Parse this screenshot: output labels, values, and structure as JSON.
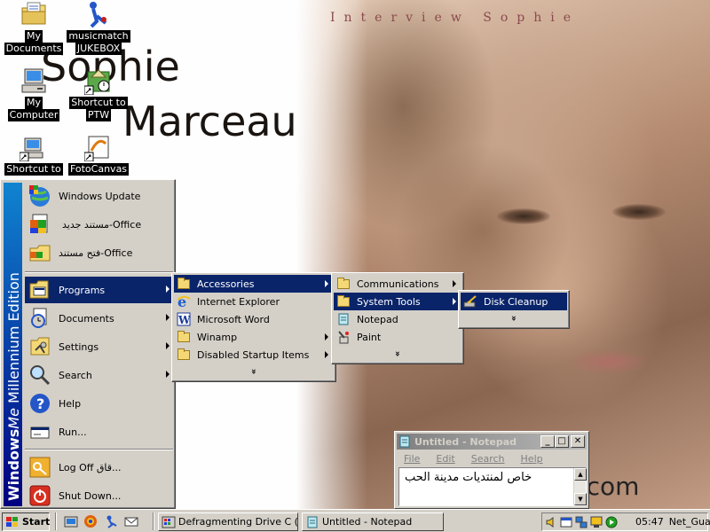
{
  "desktop": {
    "wallpaper": {
      "caption": "Interview Sophie",
      "name_first": "Sophie",
      "name_last": "Marceau",
      "url": "www.ma...ng.com"
    },
    "icons": [
      {
        "label_line1": "My",
        "label_line2": "Documents",
        "icon": "folder-documents-icon"
      },
      {
        "label_line1": "musicmatch",
        "label_line2": "JUKEBOX",
        "icon": "musicmatch-icon"
      },
      {
        "label_line1": "My",
        "label_line2": "Computer",
        "icon": "computer-icon"
      },
      {
        "label_line1": "Shortcut to",
        "label_line2": "PTW",
        "icon": "ptw-shortcut-icon"
      },
      {
        "label_line1": "Shortcut to",
        "label_line2": "",
        "icon": "shortcut-icon"
      },
      {
        "label_line1": "FotoCanvas",
        "label_line2": "",
        "icon": "fotocanvas-icon"
      }
    ]
  },
  "start_menu": {
    "banner_brand": "Windows",
    "banner_me": "Me",
    "banner_edition": "Millennium Edition",
    "pinned": [
      {
        "label": "Windows Update",
        "icon": "windows-update-icon"
      },
      {
        "label": "مستند جديد-Office",
        "icon": "office-new-icon"
      },
      {
        "label": "فتح مستند-Office",
        "icon": "office-open-icon"
      }
    ],
    "items": [
      {
        "label": "Programs",
        "icon": "programs-icon",
        "has_submenu": true,
        "highlighted": true
      },
      {
        "label": "Documents",
        "icon": "documents-icon",
        "has_submenu": true
      },
      {
        "label": "Settings",
        "icon": "settings-icon",
        "has_submenu": true
      },
      {
        "label": "Search",
        "icon": "search-icon",
        "has_submenu": true
      },
      {
        "label": "Help",
        "icon": "help-icon",
        "has_submenu": false
      },
      {
        "label": "Run...",
        "icon": "run-icon",
        "has_submenu": false
      }
    ],
    "logoff_label": "Log Off قاق...",
    "shutdown_label": "Shut Down..."
  },
  "programs_menu": {
    "items": [
      {
        "label": "Accessories",
        "icon": "folder-icon",
        "has_submenu": true,
        "highlighted": true
      },
      {
        "label": "Internet Explorer",
        "icon": "internet-explorer-icon",
        "has_submenu": false
      },
      {
        "label": "Microsoft Word",
        "icon": "word-icon",
        "has_submenu": false
      },
      {
        "label": "Winamp",
        "icon": "folder-icon",
        "has_submenu": true
      },
      {
        "label": "Disabled Startup Items",
        "icon": "folder-icon",
        "has_submenu": true
      }
    ],
    "more": "»"
  },
  "accessories_menu": {
    "items": [
      {
        "label": "Communications",
        "icon": "folder-icon",
        "has_submenu": true
      },
      {
        "label": "System Tools",
        "icon": "folder-icon",
        "has_submenu": true,
        "highlighted": true
      },
      {
        "label": "Notepad",
        "icon": "notepad-icon",
        "has_submenu": false
      },
      {
        "label": "Paint",
        "icon": "paint-icon",
        "has_submenu": false
      }
    ],
    "more": "»"
  },
  "system_tools_menu": {
    "items": [
      {
        "label": "Disk Cleanup",
        "icon": "disk-cleanup-icon",
        "highlighted": true
      }
    ],
    "more": "»"
  },
  "notepad": {
    "title": "Untitled - Notepad",
    "menu": [
      "File",
      "Edit",
      "Search",
      "Help"
    ],
    "text": "خاص لمنتديات مدينة الحب"
  },
  "taskbar": {
    "start_label": "Start",
    "tasks": [
      {
        "label": "Defragmenting Drive C (p...",
        "icon": "defrag-icon"
      },
      {
        "label": "Untitled - Notepad",
        "icon": "notepad-icon"
      }
    ],
    "clock": "05:47",
    "tray_label": "Net_Guard"
  },
  "colors": {
    "menu_highlight": "#0a246a",
    "face": "#d4d0c8",
    "banner_top": "#1084d0",
    "banner_bottom": "#000080"
  }
}
